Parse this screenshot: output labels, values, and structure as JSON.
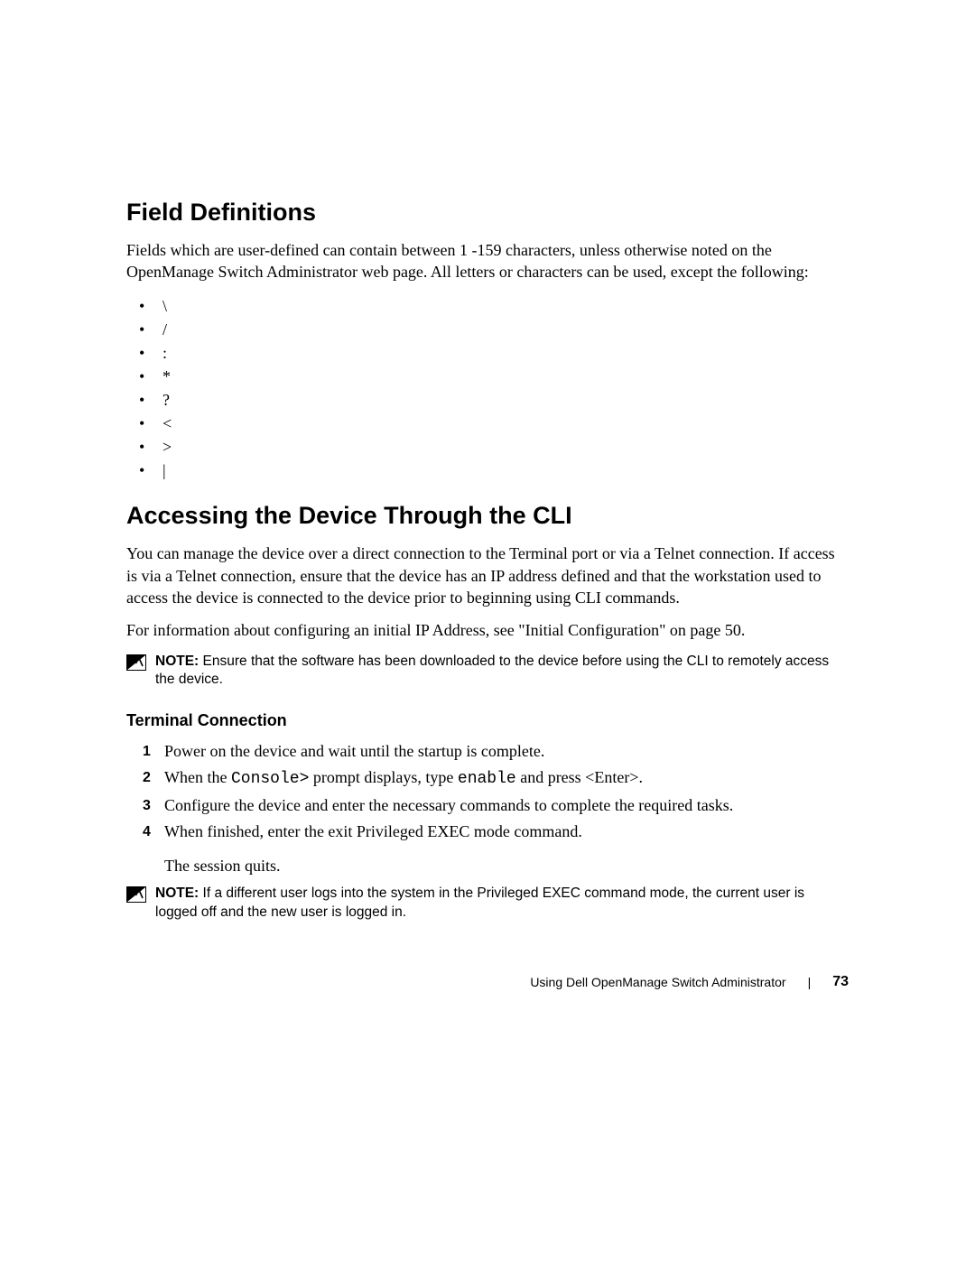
{
  "section1": {
    "title": "Field Definitions",
    "intro": "Fields which are user-defined can contain between 1 -159 characters, unless otherwise noted on the OpenManage Switch Administrator web page. All letters or characters can be used, except the following:",
    "chars": [
      "\\",
      "/",
      ":",
      "*",
      "?",
      "<",
      ">",
      "|"
    ]
  },
  "section2": {
    "title": "Accessing the Device Through the CLI",
    "p1": "You can manage the device over a direct connection to the Terminal port or via a Telnet connection. If access is via a Telnet connection, ensure that the device has an IP address defined and that the workstation used to access the device is connected to the device prior to beginning using CLI commands.",
    "p2": "For information about configuring an initial IP Address, see \"Initial Configuration\" on page 50.",
    "note1_label": "NOTE:",
    "note1_text": " Ensure that the software has been downloaded to the device before using the CLI to remotely access the device.",
    "sub": "Terminal Connection",
    "steps": {
      "s1": "Power on the device and wait until the startup is complete.",
      "s2a": "When the ",
      "s2_code1": "Console>",
      "s2b": " prompt displays, type ",
      "s2_code2": "enable",
      "s2c": " and press <Enter>.",
      "s3": "Configure the device and enter the necessary commands to complete the required tasks.",
      "s4": "When finished, enter the exit Privileged EXEC mode command.",
      "s4_extra": "The session quits."
    },
    "note2_label": "NOTE:",
    "note2_text": " If a different user logs into the system in the Privileged EXEC command mode, the current user is logged off and the new user is logged in."
  },
  "footer": {
    "title": "Using Dell OpenManage Switch Administrator",
    "sep": "|",
    "page": "73"
  }
}
